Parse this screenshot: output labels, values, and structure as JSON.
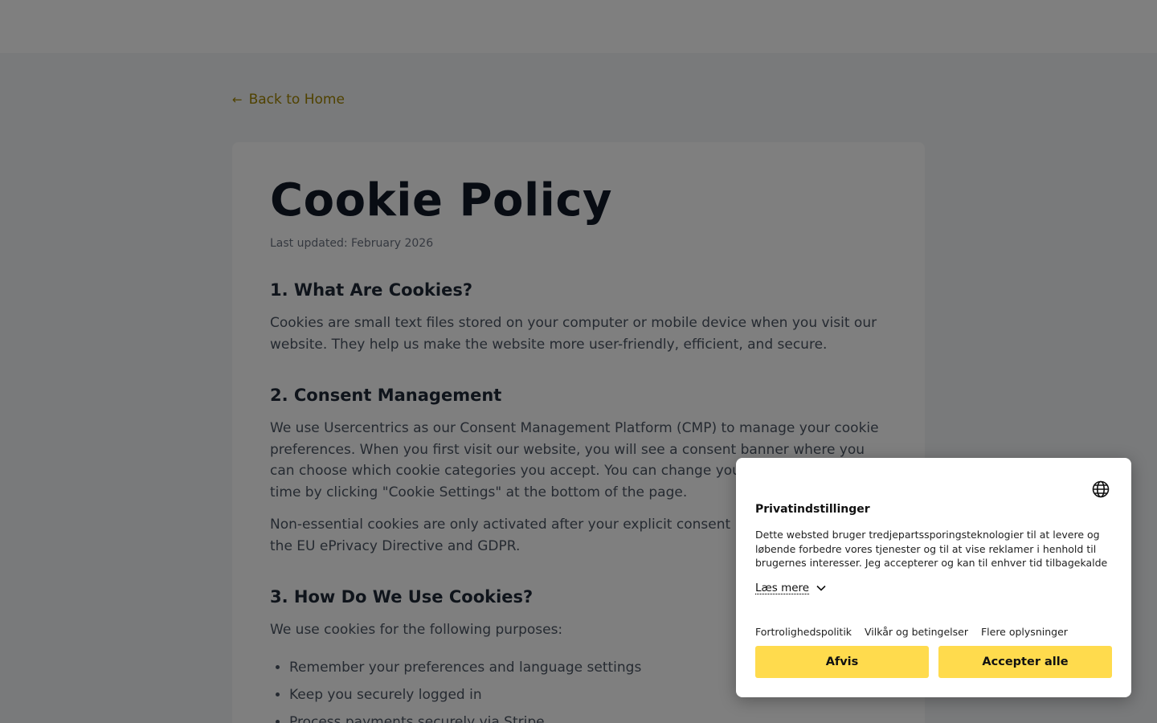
{
  "nav": {
    "back_label": "Back to Home",
    "back_arrow": "←"
  },
  "page": {
    "title": "Cookie Policy",
    "updated": "Last updated: February 2026",
    "sections": [
      {
        "heading": "1. What Are Cookies?",
        "paragraphs": [
          "Cookies are small text files stored on your computer or mobile device when you visit our website. They help us make the website more user-friendly, efficient, and secure."
        ]
      },
      {
        "heading": "2. Consent Management",
        "paragraphs": [
          "We use Usercentrics as our Consent Management Platform (CMP) to manage your cookie preferences. When you first visit our website, you will see a consent banner where you can choose which cookie categories you accept. You can change your preferences at any time by clicking \"Cookie Settings\" at the bottom of the page.",
          "Non-essential cookies are only activated after your explicit consent in accordance with the EU ePrivacy Directive and GDPR."
        ]
      },
      {
        "heading": "3. How Do We Use Cookies?",
        "paragraphs": [
          "We use cookies for the following purposes:"
        ],
        "list": [
          "Remember your preferences and language settings",
          "Keep you securely logged in",
          "Process payments securely via Stripe"
        ]
      }
    ]
  },
  "consent": {
    "title": "Privatindstillinger",
    "text": "Dette websted bruger tredjepartssporingsteknologier til at levere og løbende forbedre vores tjenester og til at vise reklamer i henhold til brugernes interesser. Jeg accepterer og kan til enhver tid tilbagekalde eller ændre mit samtykke med virkning for fremtiden.",
    "read_more": "Læs mere",
    "links": [
      "Fortrolighedspolitik",
      "Vilkår og betingelser",
      "Flere oplysninger"
    ],
    "deny_label": "Afvis",
    "accept_label": "Accepter alle",
    "button_color": "#ffdb4d"
  }
}
